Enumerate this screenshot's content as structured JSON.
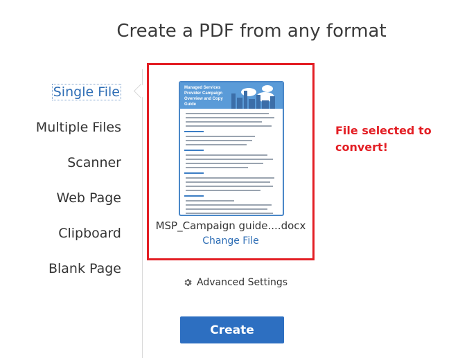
{
  "page": {
    "title": "Create a PDF from any format"
  },
  "nav": {
    "items": [
      {
        "label": "Single File",
        "active": true
      },
      {
        "label": "Multiple Files"
      },
      {
        "label": "Scanner"
      },
      {
        "label": "Web Page"
      },
      {
        "label": "Clipboard"
      },
      {
        "label": "Blank Page"
      }
    ]
  },
  "file": {
    "thumbnail_title": "Managed Services Provider Campaign Overview and Copy Guide",
    "name": "MSP_Campaign guide....docx",
    "change_label": "Change File"
  },
  "annotation": {
    "text": "File selected to convert!"
  },
  "settings": {
    "label": "Advanced Settings",
    "icon": "gear-icon"
  },
  "actions": {
    "create_label": "Create"
  },
  "colors": {
    "accent": "#2d6fc1",
    "annotation": "#e31e24",
    "link": "#2d6db5"
  }
}
